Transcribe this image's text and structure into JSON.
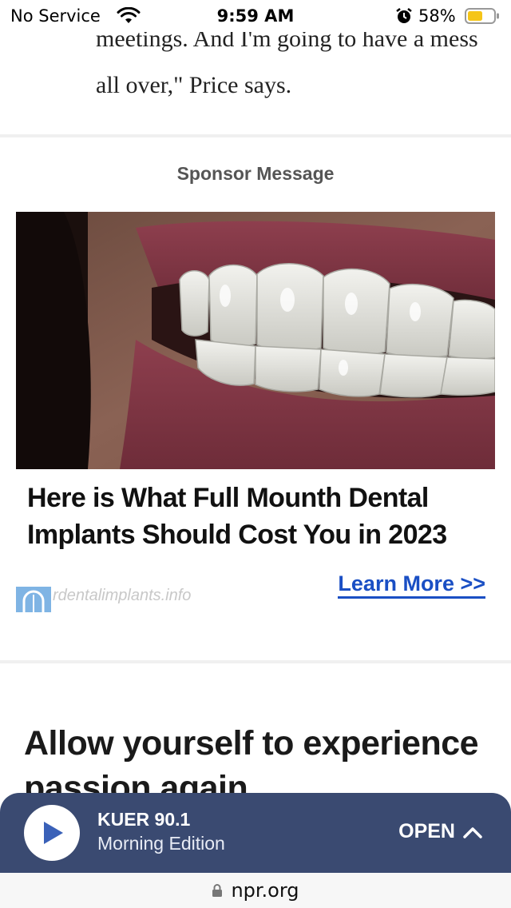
{
  "status_bar": {
    "carrier": "No Service",
    "time": "9:59 AM",
    "battery_percent": "58%",
    "battery_level": 0.58,
    "battery_color": "#f5c518"
  },
  "article": {
    "paragraph_tail": "meetings. And I'm going to have a mess all over,\" Price says.",
    "next_heading": "Allow yourself to experience passion again"
  },
  "sponsor": {
    "label": "Sponsor Message",
    "headline": "Here is What Full Mounth Dental Implants Should Cost You in 2023",
    "domain": "rdentalimplants.info",
    "cta": "Learn More >>",
    "cta_color": "#1a4fc4"
  },
  "player": {
    "station": "KUER 90.1",
    "show": "Morning Edition",
    "open_label": "OPEN",
    "background": "#3a4a71"
  },
  "url_bar": {
    "domain": "npr.org"
  },
  "icons": [
    "wifi-icon",
    "alarm-icon",
    "battery-icon",
    "play-icon",
    "chevron-up-icon",
    "lock-icon"
  ]
}
